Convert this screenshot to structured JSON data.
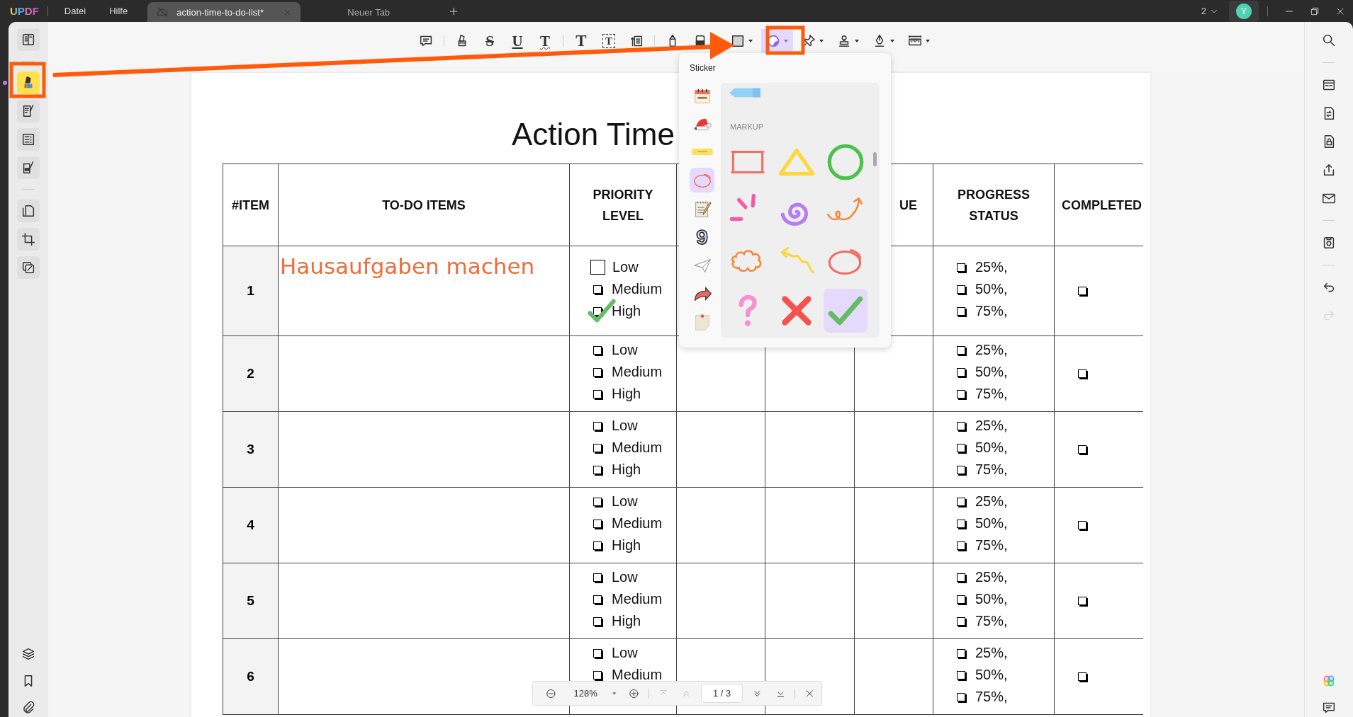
{
  "app": {
    "logo": "UPDF",
    "menu": [
      {
        "label": "Datei"
      },
      {
        "label": "Hilfe"
      }
    ],
    "tabs": [
      {
        "label": "action-time-to-do-list*",
        "selected": true
      },
      {
        "label": "Neuer Tab",
        "selected": false
      }
    ],
    "counter": "2",
    "avatar": "Y"
  },
  "left_sidebar": {
    "groups": [
      {
        "items": [
          {
            "kind": "book",
            "selected": false
          }
        ]
      },
      {
        "items": [
          {
            "kind": "highlighter",
            "selected": true
          },
          {
            "kind": "page-edit",
            "selected": false
          },
          {
            "kind": "form",
            "selected": false
          },
          {
            "kind": "page-sign",
            "selected": false
          }
        ]
      },
      {
        "items": [
          {
            "kind": "pages",
            "selected": false
          },
          {
            "kind": "crop",
            "selected": false
          },
          {
            "kind": "duplicate",
            "selected": false
          }
        ]
      }
    ],
    "bottom": [
      {
        "kind": "layers"
      },
      {
        "kind": "bookmark"
      },
      {
        "kind": "paperclip"
      }
    ]
  },
  "toolbar": {
    "groups": [
      {
        "tools": [
          {
            "kind": "comment",
            "selected": false,
            "dropdown": false
          }
        ]
      },
      {
        "tools": [
          {
            "kind": "marker",
            "selected": false,
            "dropdown": false
          },
          {
            "kind": "strikethrough",
            "glyph": "S",
            "selected": false,
            "dropdown": false
          },
          {
            "kind": "underline",
            "glyph": "U",
            "selected": false,
            "dropdown": false
          },
          {
            "kind": "squiggly",
            "glyph": "T",
            "selected": false,
            "dropdown": false
          }
        ]
      },
      {
        "tools": [
          {
            "kind": "text",
            "glyph": "T",
            "selected": false,
            "dropdown": false
          },
          {
            "kind": "text-box",
            "glyph": "T",
            "selected": false,
            "dropdown": false
          },
          {
            "kind": "text-callout",
            "selected": false,
            "dropdown": false
          }
        ]
      },
      {
        "tools": [
          {
            "kind": "pencil",
            "selected": false,
            "dropdown": false
          },
          {
            "kind": "eraser",
            "selected": false,
            "dropdown": false
          },
          {
            "kind": "square",
            "selected": false,
            "dropdown": true
          },
          {
            "kind": "sticker",
            "selected": true,
            "dropdown": true
          },
          {
            "kind": "pin",
            "selected": false,
            "dropdown": true
          },
          {
            "kind": "stamp",
            "selected": false,
            "dropdown": true
          },
          {
            "kind": "pen-nib",
            "selected": false,
            "dropdown": true
          },
          {
            "kind": "ruler",
            "selected": false,
            "dropdown": true
          }
        ]
      }
    ]
  },
  "sticker_popup": {
    "title": "Sticker",
    "categories": [
      {
        "kind": "calendar",
        "selected": false
      },
      {
        "kind": "hat",
        "selected": false
      },
      {
        "kind": "tape",
        "selected": false
      },
      {
        "kind": "ring",
        "selected": true
      },
      {
        "kind": "notepad",
        "selected": false
      },
      {
        "kind": "number",
        "glyph": "9",
        "selected": false
      },
      {
        "kind": "paper-plane",
        "selected": false
      },
      {
        "kind": "curved-arrow",
        "selected": false
      },
      {
        "kind": "note-paper",
        "selected": false
      }
    ],
    "scrolled_row": [
      {
        "kind": "tag"
      }
    ],
    "section": "MARKUP",
    "stickers": [
      {
        "kind": "rectangle",
        "selected": false
      },
      {
        "kind": "triangle",
        "selected": false
      },
      {
        "kind": "circle",
        "selected": false
      },
      {
        "kind": "burst",
        "selected": false
      },
      {
        "kind": "spiral",
        "selected": false
      },
      {
        "kind": "loop-arrow",
        "selected": false
      },
      {
        "kind": "cloud",
        "selected": false
      },
      {
        "kind": "squiggle-arrow",
        "selected": false
      },
      {
        "kind": "ellipse",
        "selected": false
      },
      {
        "kind": "question",
        "selected": false
      },
      {
        "kind": "cross",
        "selected": false
      },
      {
        "kind": "check",
        "selected": true
      }
    ]
  },
  "document": {
    "title": "Action Time",
    "columns": [
      {
        "label": "#ITEM"
      },
      {
        "label": "TO-DO ITEMS"
      },
      {
        "label": "PRIORITY LEVEL"
      },
      {},
      {},
      {
        "label": "UE"
      },
      {
        "label": "PROGRESS STATUS"
      },
      {
        "label": "COMPLETED"
      }
    ],
    "rows": [
      {
        "number": "1",
        "todo": "Hausaufgaben machen",
        "check_sticker": true,
        "priority": [
          {
            "label": "Low",
            "kind": "square",
            "checked": false
          },
          {
            "label": "Medium",
            "kind": "box",
            "checked": false
          },
          {
            "label": "High",
            "kind": "box",
            "checked": false
          }
        ],
        "progress": [
          {
            "label": "25%,",
            "checked": false
          },
          {
            "label": "50%,",
            "checked": false
          },
          {
            "label": "75%,",
            "checked": false
          }
        ],
        "completed": {
          "checked": false
        }
      },
      {
        "number": "2",
        "check_sticker": false,
        "priority": [
          {
            "label": "Low",
            "kind": "box",
            "checked": false
          },
          {
            "label": "Medium",
            "kind": "box",
            "checked": false
          },
          {
            "label": "High",
            "kind": "box",
            "checked": false
          }
        ],
        "progress": [
          {
            "label": "25%,",
            "checked": false
          },
          {
            "label": "50%,",
            "checked": false
          },
          {
            "label": "75%,",
            "checked": false
          }
        ],
        "completed": {
          "checked": false
        }
      },
      {
        "number": "3",
        "check_sticker": false,
        "priority": [
          {
            "label": "Low",
            "kind": "box",
            "checked": false
          },
          {
            "label": "Medium",
            "kind": "box",
            "checked": false
          },
          {
            "label": "High",
            "kind": "box",
            "checked": false
          }
        ],
        "progress": [
          {
            "label": "25%,",
            "checked": false
          },
          {
            "label": "50%,",
            "checked": false
          },
          {
            "label": "75%,",
            "checked": false
          }
        ],
        "completed": {
          "checked": false
        }
      },
      {
        "number": "4",
        "check_sticker": false,
        "priority": [
          {
            "label": "Low",
            "kind": "box",
            "checked": false
          },
          {
            "label": "Medium",
            "kind": "box",
            "checked": false
          },
          {
            "label": "High",
            "kind": "box",
            "checked": false
          }
        ],
        "progress": [
          {
            "label": "25%,",
            "checked": false
          },
          {
            "label": "50%,",
            "checked": false
          },
          {
            "label": "75%,",
            "checked": false
          }
        ],
        "completed": {
          "checked": false
        }
      },
      {
        "number": "5",
        "check_sticker": false,
        "priority": [
          {
            "label": "Low",
            "kind": "box",
            "checked": false
          },
          {
            "label": "Medium",
            "kind": "box",
            "checked": false
          },
          {
            "label": "High",
            "kind": "box",
            "checked": false
          }
        ],
        "progress": [
          {
            "label": "25%,",
            "checked": false
          },
          {
            "label": "50%,",
            "checked": false
          },
          {
            "label": "75%,",
            "checked": false
          }
        ],
        "completed": {
          "checked": false
        }
      },
      {
        "number": "6",
        "check_sticker": false,
        "priority": [
          {
            "label": "Low",
            "kind": "box",
            "checked": false
          },
          {
            "label": "Medium",
            "kind": "box",
            "checked": false
          }
        ],
        "progress": [
          {
            "label": "25%,",
            "checked": false
          },
          {
            "label": "50%,",
            "checked": false
          },
          {
            "label": "75%,",
            "checked": false
          }
        ],
        "completed": {
          "checked": false
        }
      }
    ]
  },
  "zoom_bar": {
    "zoom": "128%",
    "page": "1 / 3",
    "buttons": [
      {
        "kind": "first-page",
        "disabled": true
      },
      {
        "kind": "previous-page",
        "disabled": true
      },
      {
        "kind": "next-page",
        "disabled": false
      },
      {
        "kind": "last-page",
        "disabled": false
      }
    ]
  },
  "right_sidebar": {
    "groups": [
      {
        "items": [
          {
            "kind": "search",
            "disabled": false
          }
        ]
      },
      {
        "items": [
          {
            "kind": "ocr",
            "disabled": false
          },
          {
            "kind": "page-convert",
            "disabled": false
          },
          {
            "kind": "page-lock",
            "disabled": false
          },
          {
            "kind": "share",
            "disabled": false
          },
          {
            "kind": "mail",
            "disabled": false
          }
        ]
      },
      {
        "items": [
          {
            "kind": "page-scan",
            "disabled": false
          }
        ]
      },
      {
        "items": [
          {
            "kind": "undo",
            "disabled": false
          },
          {
            "kind": "redo",
            "disabled": true
          }
        ]
      }
    ],
    "bottom": [
      {
        "kind": "sparkle",
        "disabled": false
      },
      {
        "kind": "comment",
        "disabled": false
      }
    ]
  }
}
